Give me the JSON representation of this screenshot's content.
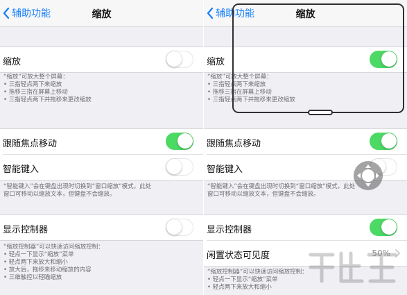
{
  "left": {
    "nav": {
      "back_label": "辅助功能",
      "title": "缩放"
    },
    "zoom_row": {
      "label": "缩放",
      "toggle": "off"
    },
    "zoom_note": {
      "intro": "“缩放”可放大整个屏幕：",
      "lines": [
        "• 三指轻点两下来缩放",
        "• 拖移三指在屏幕上移动",
        "• 三指轻点两下并拖移来更改缩放"
      ]
    },
    "follow_row": {
      "label": "跟随焦点移动",
      "toggle": "on"
    },
    "smart_row": {
      "label": "智能键入",
      "toggle": "off"
    },
    "smart_note": {
      "line1": "“智能键入”会在键盘出现时切换到“窗口缩放”模式，此处",
      "line2": "窗口可移动以缩放文本，但键盘不会缩放。"
    },
    "controller_row": {
      "label": "显示控制器",
      "toggle": "off"
    },
    "controller_note": {
      "intro": "“缩放控制器”可以快速访问缩放控制：",
      "lines": [
        "• 轻点一下显示“缩放”菜单",
        "• 轻点两下来放大和缩小",
        "• 放大后，拖移来移动缩放的内容",
        "• 三维触控以轻瞄缩放"
      ]
    }
  },
  "right": {
    "nav": {
      "back_label": "辅助功能",
      "title": "缩放"
    },
    "zoom_row": {
      "label": "缩放",
      "toggle": "on"
    },
    "zoom_note": {
      "intro": "“缩放”可放大整个屏幕：",
      "lines": [
        "• 三指轻点两下来缩放",
        "• 拖移三指在屏幕上移动",
        "• 三指轻点两下并拖移来更改缩放"
      ]
    },
    "follow_row": {
      "label": "跟随焦点移动",
      "toggle": "on"
    },
    "smart_row": {
      "label": "智能键入",
      "toggle": "off"
    },
    "smart_note": {
      "line1": "“智能键入”会在键盘出现时切换到“窗口缩放”模式，此处",
      "line2": "窗口可移动以缩放文本，但键盘不会缩放。"
    },
    "controller_row": {
      "label": "显示控制器",
      "toggle": "on"
    },
    "idle_row": {
      "label": "闲置状态可见度",
      "value": "50%"
    },
    "controller_note": {
      "intro": "“缩放控制器”可以快速访问缩放控制：",
      "lines": [
        "• 轻点一下显示“缩放”菜单",
        "• 轻点两下来放大和缩小"
      ]
    }
  },
  "colors": {
    "accent": "#157efb",
    "toggle_on": "#4cd964",
    "background": "#efeff4"
  },
  "icons": [
    "chevron-left-icon",
    "chevron-right-icon",
    "zoom-controller-icon"
  ]
}
